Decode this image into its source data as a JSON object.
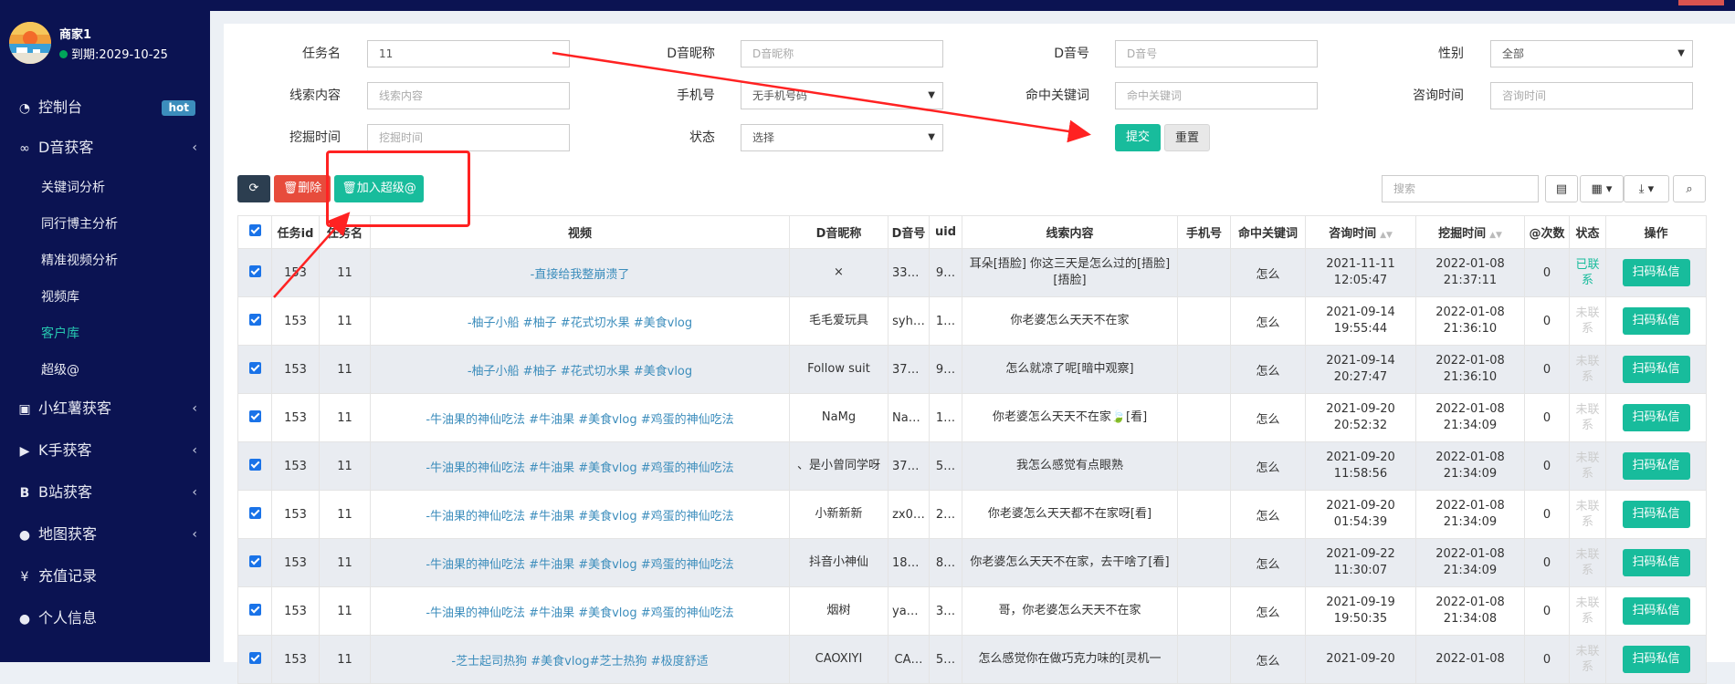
{
  "user": {
    "name": "商家1",
    "expire": "到期:2029-10-25"
  },
  "nav": {
    "dashboard": "控制台",
    "hot_badge": "hot",
    "douyin": "D音获客",
    "keyword_analysis": "关键词分析",
    "peer_analysis": "同行博主分析",
    "video_analysis": "精准视频分析",
    "video_lib": "视频库",
    "customer_lib": "客户库",
    "super_at": "超级@",
    "xhs": "小红薯获客",
    "kuaishou": "K手获客",
    "bilibili": "B站获客",
    "map": "地图获客",
    "recharge": "充值记录",
    "profile": "个人信息"
  },
  "filter": {
    "task_name_label": "任务名",
    "task_name_value": "11",
    "nick_label": "D音昵称",
    "nick_placeholder": "D音昵称",
    "dyid_label": "D音号",
    "dyid_placeholder": "D音号",
    "gender_label": "性别",
    "gender_value": "全部",
    "clue_label": "线索内容",
    "clue_placeholder": "线索内容",
    "phone_label": "手机号",
    "phone_value": "无手机号码",
    "hit_label": "命中关键词",
    "hit_placeholder": "命中关键词",
    "consult_label": "咨询时间",
    "consult_placeholder": "咨询时间",
    "mine_label": "挖掘时间",
    "mine_placeholder": "挖掘时间",
    "status_label": "状态",
    "status_value": "选择",
    "submit": "提交",
    "reset": "重置"
  },
  "toolbar": {
    "delete": "删除",
    "add_super": "加入超级@",
    "search_placeholder": "搜索"
  },
  "table": {
    "headers": [
      "任务id",
      "任务名",
      "视频",
      "D音昵称",
      "D音号",
      "uid",
      "线索内容",
      "手机号",
      "命中关键词",
      "咨询时间",
      "挖掘时间",
      "@次数",
      "状态",
      "操作"
    ],
    "action": "扫码私信",
    "rows": [
      {
        "task_id": "153",
        "task": "11",
        "video": "-直接给我整崩溃了",
        "nick": "×",
        "dyid": "330…",
        "uid": "9…",
        "clue": "耳朵[捂脸] 你这三天是怎么过的[捂脸][捂脸]",
        "phone": "",
        "hit": "怎么",
        "consult": "2021-11-11 12:05:47",
        "mined": "2022-01-08 21:37:11",
        "at": "0",
        "status": "已联系",
        "contacted": true
      },
      {
        "task_id": "153",
        "task": "11",
        "video": "-柚子小船 #柚子 #花式切水果 #美食vlog",
        "nick": "毛毛爱玩具",
        "dyid": "syh…",
        "uid": "1…",
        "clue": "你老婆怎么天天不在家",
        "phone": "",
        "hit": "怎么",
        "consult": "2021-09-14 19:55:44",
        "mined": "2022-01-08 21:36:10",
        "at": "0",
        "status": "未联系",
        "contacted": false
      },
      {
        "task_id": "153",
        "task": "11",
        "video": "-柚子小船 #柚子 #花式切水果 #美食vlog",
        "nick": "Follow suit",
        "dyid": "376…",
        "uid": "9…",
        "clue": "怎么就凉了呢[暗中观察]",
        "phone": "",
        "hit": "怎么",
        "consult": "2021-09-14 20:27:47",
        "mined": "2022-01-08 21:36:10",
        "at": "0",
        "status": "未联系",
        "contacted": false
      },
      {
        "task_id": "153",
        "task": "11",
        "video": "-牛油果的神仙吃法 #牛油果 #美食vlog #鸡蛋的神仙吃法",
        "nick": "NaMg",
        "dyid": "NaMg",
        "uid": "1…",
        "clue": "你老婆怎么天天不在家🍃[看]",
        "phone": "",
        "hit": "怎么",
        "consult": "2021-09-20 20:52:32",
        "mined": "2022-01-08 21:34:09",
        "at": "0",
        "status": "未联系",
        "contacted": false
      },
      {
        "task_id": "153",
        "task": "11",
        "video": "-牛油果的神仙吃法 #牛油果 #美食vlog #鸡蛋的神仙吃法",
        "nick": "、是小曾同学呀",
        "dyid": "378…",
        "uid": "5…",
        "clue": "我怎么感觉有点眼熟",
        "phone": "",
        "hit": "怎么",
        "consult": "2021-09-20 11:58:56",
        "mined": "2022-01-08 21:34:09",
        "at": "0",
        "status": "未联系",
        "contacted": false
      },
      {
        "task_id": "153",
        "task": "11",
        "video": "-牛油果的神仙吃法 #牛油果 #美食vlog #鸡蛋的神仙吃法",
        "nick": "小新新新",
        "dyid": "zx0…",
        "uid": "2…",
        "clue": "你老婆怎么天天都不在家呀[看]",
        "phone": "",
        "hit": "怎么",
        "consult": "2021-09-20 01:54:39",
        "mined": "2022-01-08 21:34:09",
        "at": "0",
        "status": "未联系",
        "contacted": false
      },
      {
        "task_id": "153",
        "task": "11",
        "video": "-牛油果的神仙吃法 #牛油果 #美食vlog #鸡蛋的神仙吃法",
        "nick": "抖音小神仙",
        "dyid": "186…",
        "uid": "8…",
        "clue": "你老婆怎么天天不在家，去干啥了[看]",
        "phone": "",
        "hit": "怎么",
        "consult": "2021-09-22 11:30:07",
        "mined": "2022-01-08 21:34:09",
        "at": "0",
        "status": "未联系",
        "contacted": false
      },
      {
        "task_id": "153",
        "task": "11",
        "video": "-牛油果的神仙吃法 #牛油果 #美食vlog #鸡蛋的神仙吃法",
        "nick": "烟树",
        "dyid": "yan…",
        "uid": "3…",
        "clue": "哥，你老婆怎么天天不在家",
        "phone": "",
        "hit": "怎么",
        "consult": "2021-09-19 19:50:35",
        "mined": "2022-01-08 21:34:08",
        "at": "0",
        "status": "未联系",
        "contacted": false
      },
      {
        "task_id": "153",
        "task": "11",
        "video": "-芝士起司热狗 #美食vlog#芝士热狗 #极度舒适",
        "nick": "CAOXIYI",
        "dyid": "CA…",
        "uid": "5…",
        "clue": "怎么感觉你在做巧克力味的[灵机一",
        "phone": "",
        "hit": "怎么",
        "consult": "2021-09-20",
        "mined": "2022-01-08",
        "at": "0",
        "status": "未联系",
        "contacted": false
      }
    ]
  }
}
